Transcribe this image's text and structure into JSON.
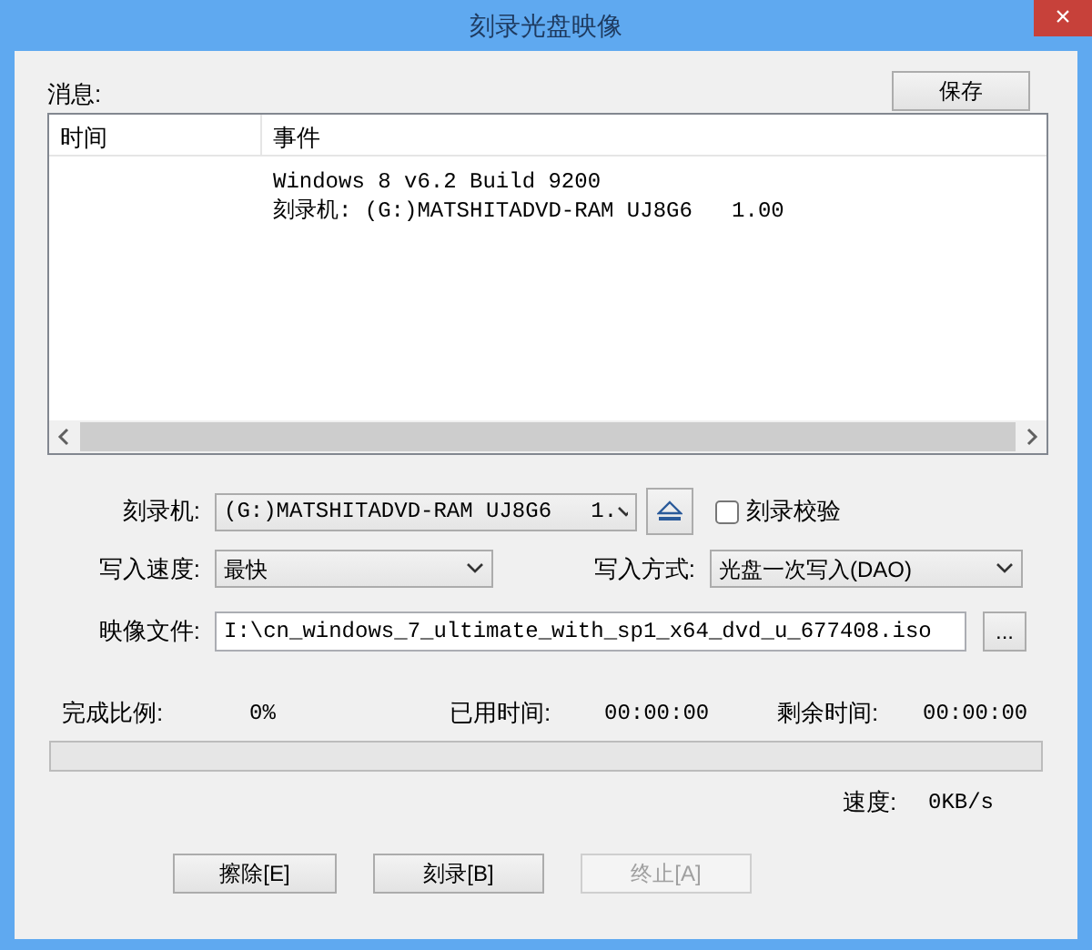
{
  "window": {
    "title": "刻录光盘映像",
    "close": "×"
  },
  "messages": {
    "label": "消息:",
    "save_button": "保存",
    "columns": [
      "时间",
      "事件"
    ],
    "rows": [
      {
        "event": "Windows 8 v6.2 Build 9200"
      },
      {
        "event": "刻录机: (G:)MATSHITADVD-RAM UJ8G6   1.00"
      }
    ]
  },
  "settings": {
    "recorder": {
      "label": "刻录机:",
      "value": "(G:)MATSHITADVD-RAM UJ8G6   1."
    },
    "verify": {
      "label": "刻录校验",
      "checked": false
    },
    "speed": {
      "label": "写入速度:",
      "value": "最快"
    },
    "mode": {
      "label": "写入方式:",
      "value": "光盘一次写入(DAO)"
    },
    "image_file": {
      "label": "映像文件:",
      "value": "I:\\cn_windows_7_ultimate_with_sp1_x64_dvd_u_677408.iso"
    },
    "browse_button": "..."
  },
  "progress": {
    "percent_label": "完成比例:",
    "percent": "0%",
    "elapsed_label": "已用时间:",
    "elapsed": "00:00:00",
    "remaining_label": "剩余时间:",
    "remaining": "00:00:00",
    "level": 0,
    "speed_label": "速度:",
    "speed": "0KB/s"
  },
  "buttons": [
    {
      "label": "擦除[E]",
      "disabled": false
    },
    {
      "label": "刻录[B]",
      "disabled": false
    },
    {
      "label": "终止[A]",
      "disabled": true
    }
  ]
}
